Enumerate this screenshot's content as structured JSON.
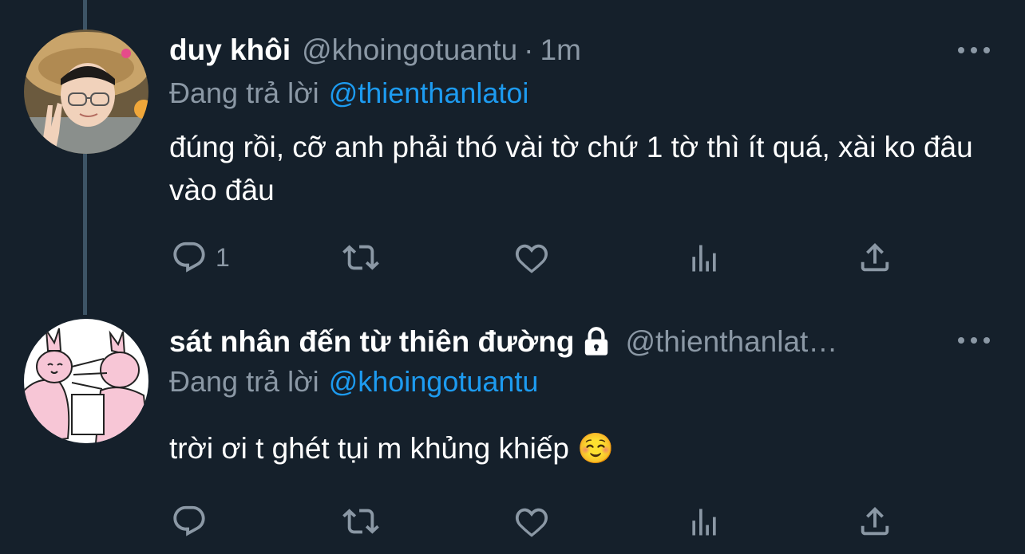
{
  "tweets": [
    {
      "display_name": "duy khôi",
      "handle": "@khoingotuantu",
      "separator": "·",
      "time": "1m",
      "replying_prefix": "Đang trả lời",
      "replying_to": "@thienthanlatoi",
      "text": "đúng rồi, cỡ anh phải thó vài tờ chứ 1 tờ thì ít quá, xài ko đâu vào đâu",
      "reply_count": "1",
      "locked": false
    },
    {
      "display_name": "sát nhân đến từ thiên đường",
      "handle": "@thienthanlat…",
      "replying_prefix": "Đang trả lời",
      "replying_to": "@khoingotuantu",
      "text": "trời ơi t ghét tụi m khủng khiếp ☺️",
      "reply_count": "",
      "locked": true
    }
  ],
  "icons": [
    "reply-icon",
    "retweet-icon",
    "like-icon",
    "analytics-icon",
    "share-icon",
    "more-icon",
    "lock-icon"
  ],
  "colors": {
    "background": "#15202b",
    "secondary_text": "#8b98a5",
    "link": "#1d9bf0",
    "thread_line": "#3d5466"
  }
}
